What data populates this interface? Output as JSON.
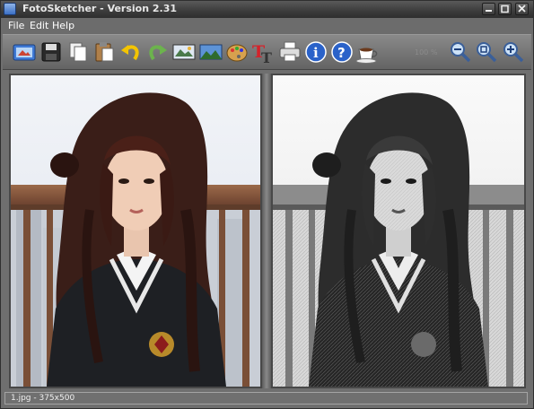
{
  "window": {
    "title": "FotoSketcher - Version 2.31"
  },
  "menu": {
    "items": [
      "File",
      "Edit",
      "Help"
    ]
  },
  "toolbar": {
    "zoom_value": "100 %",
    "buttons": [
      "open-image-icon",
      "save-icon",
      "copy-icon",
      "paste-icon",
      "undo-icon",
      "redo-icon",
      "image-settings-icon",
      "landscape-icon",
      "palette-icon",
      "add-text-icon",
      "print-icon",
      "info-icon",
      "help-icon",
      "coffee-donate-icon",
      "zoom-out-icon",
      "zoom-fit-icon",
      "zoom-in-icon"
    ]
  },
  "panes": {
    "original": {
      "description": "original photo"
    },
    "sketch": {
      "description": "pencil sketch result"
    }
  },
  "status": {
    "text": "1.jpg - 375x500"
  },
  "colors": {
    "accent": "#3a6fc4",
    "toolbar": "#787878",
    "window": "#6f6f6f"
  }
}
